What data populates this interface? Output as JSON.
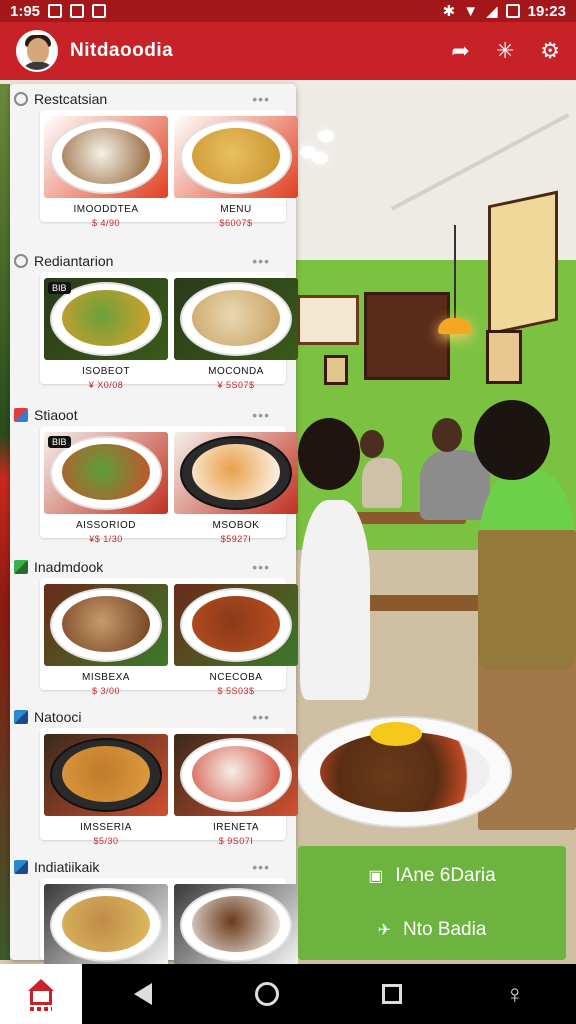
{
  "status_bar": {
    "time_left": "1:95",
    "time_right": "19:23",
    "icons_left": [
      "image-icon",
      "sync-icon",
      "gallery-icon"
    ],
    "icons_right": [
      "bluetooth-icon",
      "wifi-icon",
      "signal-icon",
      "battery-icon"
    ]
  },
  "app_bar": {
    "title": "Nitdaoodia",
    "actions": [
      "share-icon",
      "network-icon",
      "settings-icon"
    ]
  },
  "sections": [
    {
      "title": "Restcatsian",
      "icon": "gear-icon",
      "dishes": [
        {
          "name": "IMOODDTEA",
          "price": "$ 4/90",
          "badge": ""
        },
        {
          "name": "MENU",
          "price": "$6007$",
          "badge": ""
        }
      ]
    },
    {
      "title": "Rediantarion",
      "icon": "gear-icon",
      "dishes": [
        {
          "name": "ISOBEOT",
          "price": "¥ X0/08",
          "badge": "BIB"
        },
        {
          "name": "MOCONDA",
          "price": "¥ 5S07$",
          "badge": ""
        }
      ]
    },
    {
      "title": "Stiaoot",
      "icon": "flag-icon",
      "dishes": [
        {
          "name": "AISSORIOD",
          "price": "¥$ 1/30",
          "badge": "BIB"
        },
        {
          "name": "MSOBOK",
          "price": "$5927I",
          "badge": ""
        }
      ]
    },
    {
      "title": "Inadmdook",
      "icon": "flag-icon",
      "dishes": [
        {
          "name": "MISBEXA",
          "price": "$ 3/00",
          "badge": ""
        },
        {
          "name": "NCECOBA",
          "price": "$ 5S03$",
          "badge": ""
        }
      ]
    },
    {
      "title": "Natooci",
      "icon": "flag-icon",
      "dishes": [
        {
          "name": "IMSSERIA",
          "price": "$5/30",
          "badge": ""
        },
        {
          "name": "IRENETA",
          "price": "$ 9S07I",
          "badge": ""
        }
      ]
    },
    {
      "title": "Indiatiikaik",
      "icon": "flag-icon",
      "dishes": [
        {
          "name": "",
          "price": "",
          "badge": ""
        },
        {
          "name": "",
          "price": "",
          "badge": ""
        }
      ]
    }
  ],
  "actions": {
    "primary_label": "IAne 6Daria",
    "primary_icon": "menu-icon",
    "secondary_label": "Nto Badia",
    "secondary_icon": "gift-icon"
  },
  "colors": {
    "brand": "#c62228",
    "action_green": "#6cb33f",
    "price_red": "#c6282a"
  }
}
